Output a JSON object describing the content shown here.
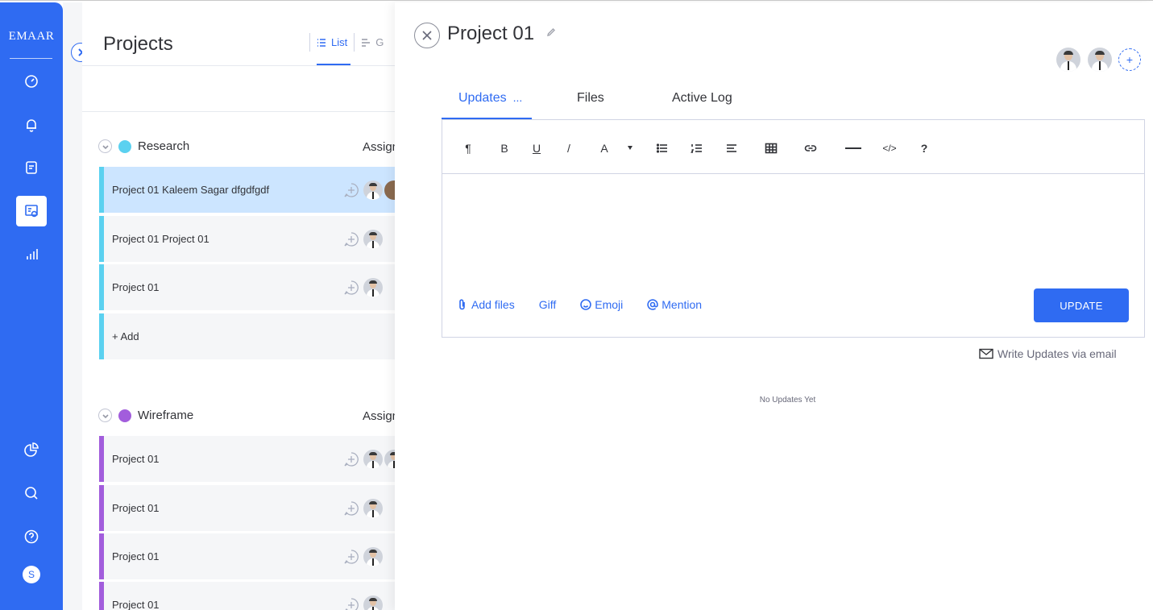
{
  "sidebar": {
    "brand": "EMAAR",
    "icons": [
      "dashboard-icon",
      "bell-icon",
      "notes-icon",
      "projects-icon",
      "analytics-icon",
      "pie-chart-icon",
      "search-icon",
      "help-icon"
    ],
    "user_initial": "S"
  },
  "board": {
    "title": "Projects",
    "views": [
      {
        "label": "List"
      },
      {
        "label": "G"
      }
    ],
    "column_assign": "Assign",
    "groups": [
      {
        "name": "Research",
        "color": "#5bd1f0",
        "rows": [
          {
            "label": "Project 01 Kaleem Sagar dfgdfgdf",
            "selected": true
          },
          {
            "label": "Project 01 Project 01",
            "selected": false
          },
          {
            "label": "Project 01",
            "selected": false
          }
        ],
        "add_label": "+ Add"
      },
      {
        "name": "Wireframe",
        "color": "#a25ddc",
        "rows": [
          {
            "label": "Project 01"
          },
          {
            "label": "Project 01"
          },
          {
            "label": "Project 01"
          },
          {
            "label": "Project 01"
          }
        ]
      }
    ]
  },
  "panel": {
    "title": "Project 01",
    "tabs": [
      {
        "label": "Updates",
        "suffix": "...",
        "active": true
      },
      {
        "label": "Files",
        "active": false
      },
      {
        "label": "Active Log",
        "active": false
      }
    ],
    "toolbar": [
      "paragraph-icon",
      "bold-icon",
      "underline-icon",
      "italic-icon",
      "font-color-icon",
      "bullet-list-icon",
      "numbered-list-icon",
      "align-icon",
      "table-icon",
      "link-icon",
      "divider-icon",
      "code-icon",
      "help-icon"
    ],
    "toolbar_text": {
      "paragraph": "¶",
      "bold": "B",
      "underline": "U",
      "italic": "/",
      "font": "A",
      "code": "</>",
      "help": "?"
    },
    "actions": {
      "add_files": "Add files",
      "giff": "Giff",
      "emoji": "Emoji",
      "mention": "Mention"
    },
    "update_button": "UPDATE",
    "email_link": "Write Updates via email",
    "empty_state": "No Updates Yet",
    "add_person": "+",
    "accent": "#2f6bf2"
  }
}
